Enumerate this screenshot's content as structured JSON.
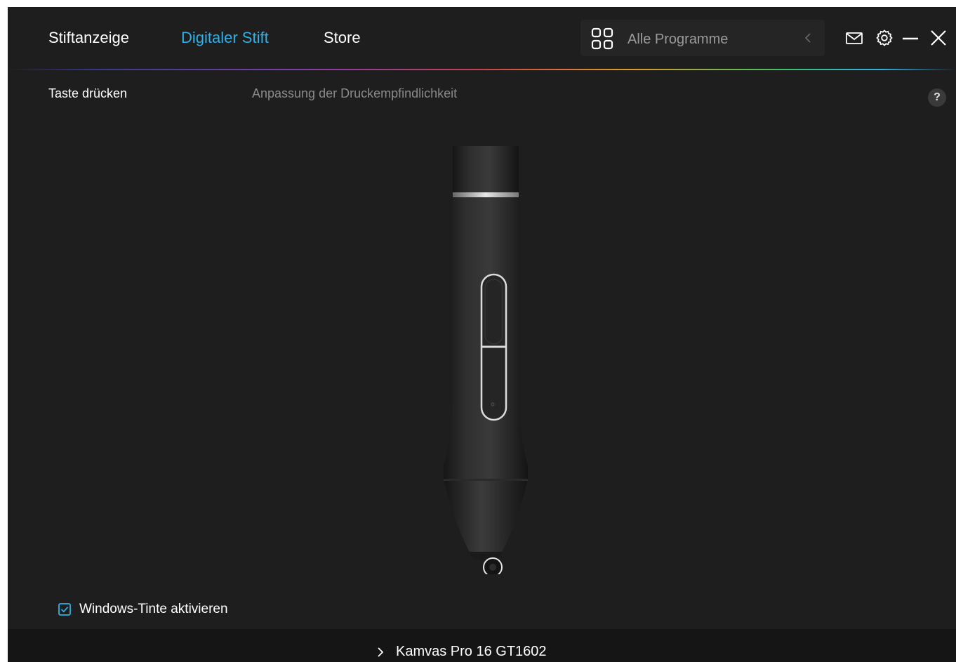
{
  "header": {
    "tabs": [
      {
        "label": "Stiftanzeige",
        "active": false
      },
      {
        "label": "Digitaler Stift",
        "active": true
      },
      {
        "label": "Store",
        "active": false
      }
    ],
    "program_select": {
      "label": "Alle Programme",
      "icon": "grid-icon",
      "nav_icon": "chevron-left-icon"
    },
    "icons": [
      "mail-icon",
      "gear-icon",
      "minimize-icon",
      "close-icon"
    ]
  },
  "subtabs": [
    {
      "label": "Taste drücken",
      "active": true
    },
    {
      "label": "Anpassung der Druckempfindlichkeit",
      "active": false
    }
  ],
  "help": {
    "label": "?"
  },
  "ink_option": {
    "label": "Windows-Tinte aktivieren",
    "checked": true
  },
  "footer": {
    "device": "Kamvas Pro 16 GT1602",
    "icon": "chevron-right-icon"
  },
  "colors": {
    "accent": "#2fb0e6",
    "background": "#1e1e1e",
    "footer": "#151515",
    "muted_text": "#8a8a8a"
  }
}
